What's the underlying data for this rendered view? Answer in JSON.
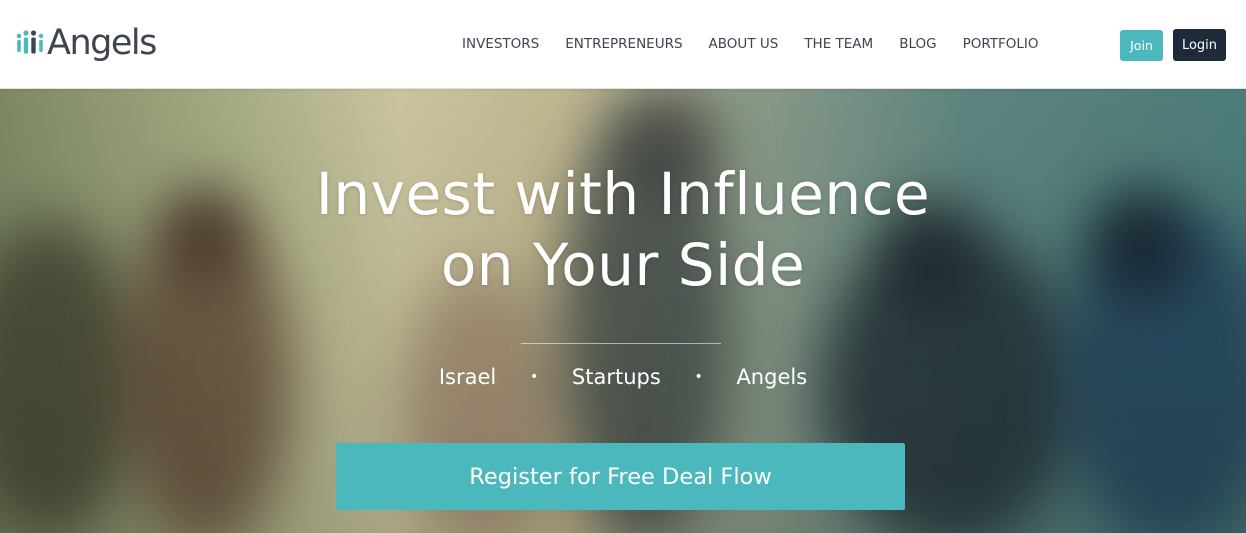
{
  "brand": {
    "name": "Angels",
    "accent_color": "#4bb8bd",
    "dark_color": "#1e2a39"
  },
  "nav": {
    "items": [
      {
        "label": "INVESTORS"
      },
      {
        "label": "ENTREPRENEURS"
      },
      {
        "label": "ABOUT US"
      },
      {
        "label": "THE TEAM"
      },
      {
        "label": "BLOG"
      },
      {
        "label": "PORTFOLIO"
      }
    ]
  },
  "auth": {
    "join_label": "Join",
    "login_label": "Login"
  },
  "hero": {
    "headline_line1": "Invest with Influence",
    "headline_line2": "on Your Side",
    "tagline": [
      "Israel",
      "Startups",
      "Angels"
    ],
    "separator": "•",
    "cta_label": "Register for Free Deal Flow"
  }
}
